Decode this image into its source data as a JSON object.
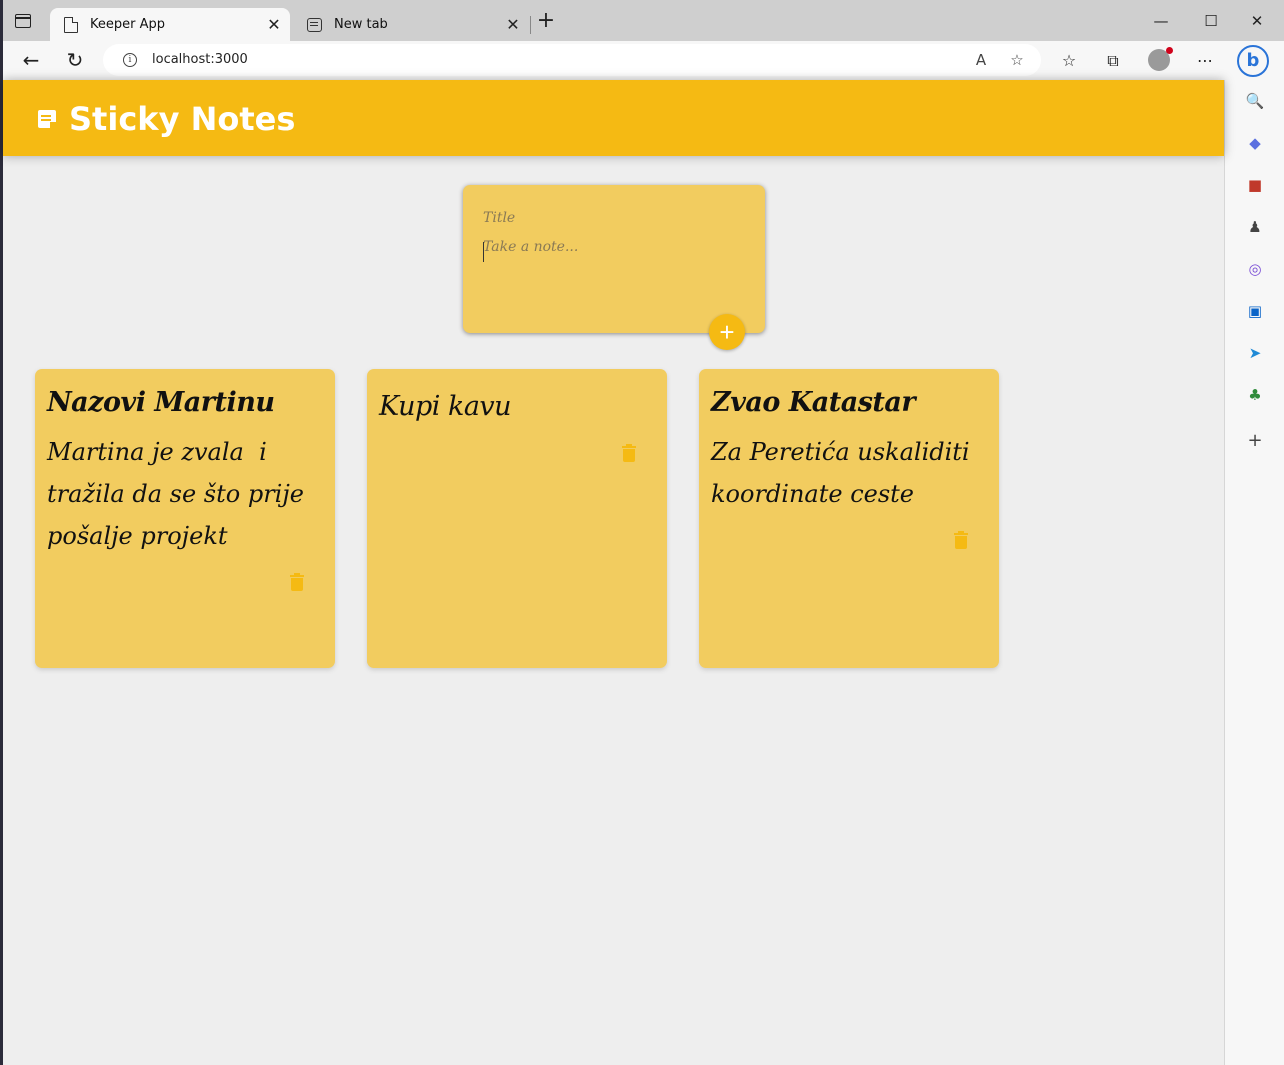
{
  "browser": {
    "tabs": [
      {
        "label": "Keeper App",
        "active": true
      },
      {
        "label": "New tab",
        "active": false
      }
    ],
    "url": "localhost:3000",
    "window_controls": [
      "minimize",
      "maximize",
      "close"
    ]
  },
  "app": {
    "title": "Sticky Notes",
    "header_color": "#f5ba13",
    "create_note": {
      "title_placeholder": "Title",
      "content_placeholder": "Take a note...",
      "add_label": "+"
    },
    "notes": [
      {
        "title": "Nazovi Martinu",
        "content": "Martina je zvala  i tražila da se što prije pošalje projekt"
      },
      {
        "title": "Kupi kavu",
        "content": ""
      },
      {
        "title": "Zvao Katastar",
        "content": "Za Peretića uskaliditi koordinate ceste"
      }
    ]
  },
  "sidebar_icons": [
    "search-icon",
    "tag-icon",
    "toolbox-icon",
    "games-icon",
    "office-icon",
    "outlook-icon",
    "send-icon",
    "tree-icon",
    "add-icon"
  ]
}
